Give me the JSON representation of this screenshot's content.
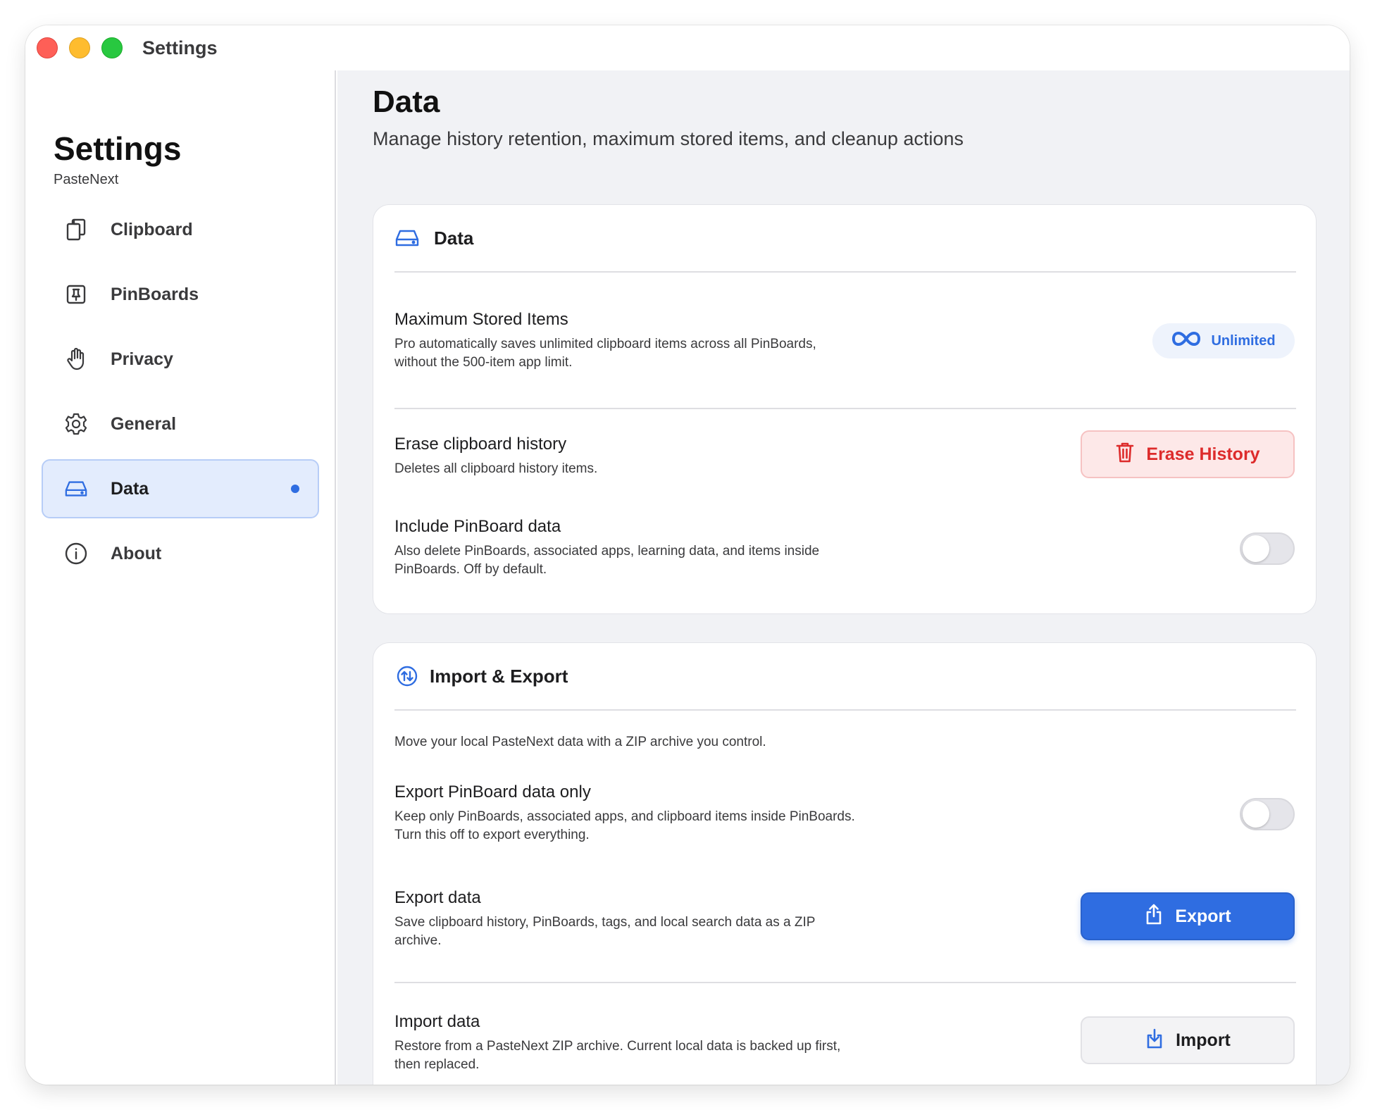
{
  "window": {
    "title": "Settings"
  },
  "sidebar": {
    "title": "Settings",
    "subtitle": "PasteNext",
    "items": [
      {
        "label": "Clipboard",
        "icon": "clipboard-icon"
      },
      {
        "label": "PinBoards",
        "icon": "pin-icon"
      },
      {
        "label": "Privacy",
        "icon": "hand-icon"
      },
      {
        "label": "General",
        "icon": "gear-icon"
      },
      {
        "label": "Data",
        "icon": "drive-icon",
        "active": true
      },
      {
        "label": "About",
        "icon": "info-icon"
      }
    ]
  },
  "page": {
    "title": "Data",
    "subtitle": "Manage history retention, maximum stored items, and cleanup actions"
  },
  "data_card": {
    "title": "Data",
    "icon": "drive-icon",
    "max_items": {
      "title": "Maximum Stored Items",
      "desc": "Pro automatically saves unlimited clipboard items across all PinBoards, without the 500-item app limit.",
      "badge": "Unlimited",
      "badge_icon": "infinity-icon"
    },
    "erase": {
      "title": "Erase clipboard history",
      "desc": "Deletes all clipboard history items.",
      "button": "Erase History",
      "button_icon": "trash-icon"
    },
    "include_pinboard": {
      "title": "Include PinBoard data",
      "desc": "Also delete PinBoards, associated apps, learning data, and items inside PinBoards. Off by default.",
      "toggle_on": false
    }
  },
  "import_export_card": {
    "title": "Import & Export",
    "icon": "arrows-updown-circle-icon",
    "intro": "Move your local PasteNext data with a ZIP archive you control.",
    "export_pinboard_only": {
      "title": "Export PinBoard data only",
      "desc": "Keep only PinBoards, associated apps, and clipboard items inside PinBoards. Turn this off to export everything.",
      "toggle_on": false
    },
    "export": {
      "title": "Export data",
      "desc": "Save clipboard history, PinBoards, tags, and local search data as a ZIP archive.",
      "button": "Export",
      "button_icon": "share-icon"
    },
    "import": {
      "title": "Import data",
      "desc": "Restore from a PasteNext ZIP archive. Current local data is backed up first, then replaced.",
      "button": "Import",
      "button_icon": "download-icon"
    }
  },
  "colors": {
    "accent": "#2f6de1",
    "danger": "#dd2b2b",
    "danger_bg": "#fde8e8",
    "main_bg": "#f1f2f5",
    "active_nav_bg": "#e3ecfd"
  }
}
